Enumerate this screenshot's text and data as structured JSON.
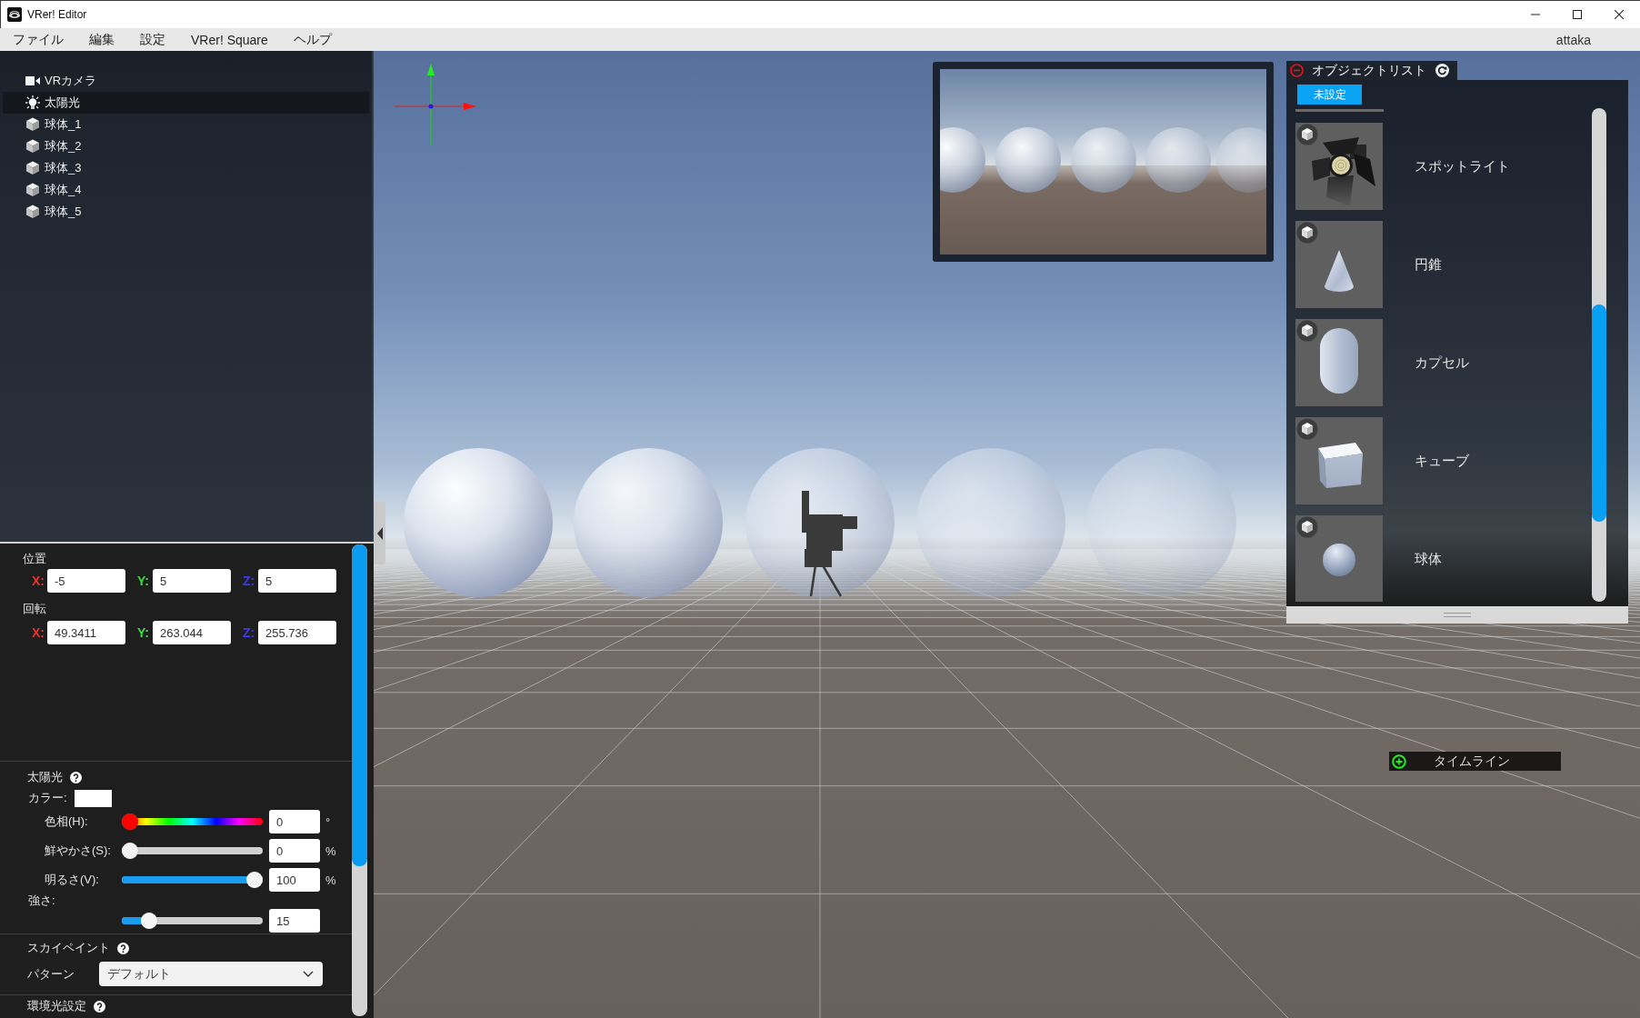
{
  "window": {
    "title": "VRer! Editor"
  },
  "menu": {
    "items": [
      "ファイル",
      "編集",
      "設定",
      "VRer! Square",
      "ヘルプ"
    ],
    "user": "attaka"
  },
  "hierarchy": {
    "items": [
      {
        "kind": "camera",
        "label": "VRカメラ",
        "selected": false
      },
      {
        "kind": "light",
        "label": "太陽光",
        "selected": true
      },
      {
        "kind": "object",
        "label": "球体_1",
        "selected": false
      },
      {
        "kind": "object",
        "label": "球体_2",
        "selected": false
      },
      {
        "kind": "object",
        "label": "球体_3",
        "selected": false
      },
      {
        "kind": "object",
        "label": "球体_4",
        "selected": false
      },
      {
        "kind": "object",
        "label": "球体_5",
        "selected": false
      }
    ]
  },
  "transform": {
    "groups": [
      {
        "title": "位置",
        "fields": [
          {
            "label": "X:",
            "value": "-5",
            "color": "#e8332e"
          },
          {
            "label": "Y:",
            "value": "5",
            "color": "#3fdc3f"
          },
          {
            "label": "Z:",
            "value": "5",
            "color": "#3b3bea"
          }
        ]
      },
      {
        "title": "回転",
        "fields": [
          {
            "label": "X:",
            "value": "49.3411",
            "color": "#e8332e"
          },
          {
            "label": "Y:",
            "value": "263.044",
            "color": "#3fdc3f"
          },
          {
            "label": "Z:",
            "value": "255.736",
            "color": "#3b3bea"
          }
        ]
      }
    ]
  },
  "sun_light": {
    "title": "太陽光",
    "color_label": "カラー:",
    "color": "#ffffff",
    "sliders": [
      {
        "kind": "hue",
        "label": "色相(H):",
        "level": 0,
        "value": "0",
        "unit": "°"
      },
      {
        "kind": "plain",
        "label": "鮮やかさ(S):",
        "level": 0,
        "value": "0",
        "unit": "%"
      },
      {
        "kind": "plain",
        "label": "明るさ(V):",
        "level": 1,
        "value": "100",
        "unit": "%"
      }
    ],
    "intensity": {
      "label": "強さ:",
      "level": 0.15,
      "value": "15"
    }
  },
  "sky_paint": {
    "title": "スカイペイント",
    "pattern_label": "パターン",
    "pattern": "デフォルト"
  },
  "ambient_light": {
    "title": "環境光設定"
  },
  "object_list": {
    "title": "オブジェクトリスト",
    "tabs": [
      {
        "label": "未設定",
        "selected": true
      }
    ],
    "items": [
      {
        "kind": "spotlight",
        "label": "スポットライト",
        "selected": false
      },
      {
        "kind": "cone",
        "label": "円錐",
        "selected": false
      },
      {
        "kind": "capsule",
        "label": "カプセル",
        "selected": false
      },
      {
        "kind": "cube",
        "label": "キューブ",
        "selected": false
      },
      {
        "kind": "sphere",
        "label": "球体",
        "selected": false
      }
    ]
  },
  "timeline": {
    "label": "タイムライン"
  }
}
